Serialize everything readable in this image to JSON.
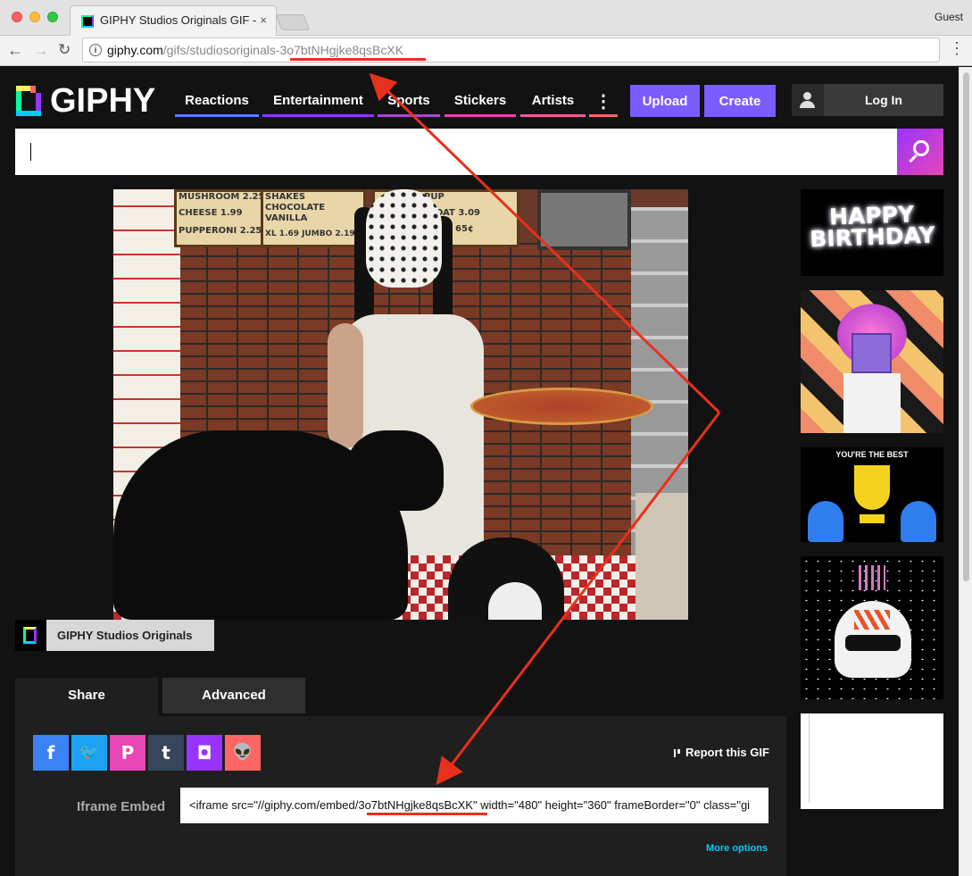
{
  "browser": {
    "tab_title": "GIPHY Studios Originals GIF - ",
    "tab_close": "×",
    "guest_label": "Guest",
    "url_domain": "giphy.com",
    "url_path": "/gifs/studiosoriginals-3o7btNHgjke8qsBcXK",
    "menu_icon": "⋮"
  },
  "header": {
    "logo_text": "GIPHY",
    "nav": [
      {
        "label": "Reactions",
        "color": "#5c7cff"
      },
      {
        "label": "Entertainment",
        "color": "#9933ff"
      },
      {
        "label": "Sports",
        "color": "#9933ff"
      },
      {
        "label": "Stickers",
        "color": "#e646b6"
      },
      {
        "label": "Artists",
        "color": "#e646b6"
      }
    ],
    "more_icon": "⋮",
    "upload_label": "Upload",
    "create_label": "Create",
    "login_label": "Log In"
  },
  "search": {
    "placeholder": ""
  },
  "gif": {
    "menu_left": [
      "MUSHROOM 2.25",
      "CHEESE 1.99",
      "PUPPERONI 2.25"
    ],
    "menu_right": [
      "SHAKES",
      "CHOCOLATE",
      "VANILLA",
      "XL 1.69 JUMBO 2.19"
    ],
    "menu_right2": [
      "PUP",
      "FLOAT 3.09",
      "65¢"
    ]
  },
  "attribution": {
    "name": "GIPHY Studios Originals"
  },
  "share": {
    "tab_share": "Share",
    "tab_advanced": "Advanced",
    "social": [
      {
        "name": "facebook",
        "glyph": "f",
        "color": "#3b82f6"
      },
      {
        "name": "twitter",
        "glyph": "🐦",
        "color": "#1da1f2"
      },
      {
        "name": "pinterest",
        "glyph": "P",
        "color": "#e646b6"
      },
      {
        "name": "tumblr",
        "glyph": "t",
        "color": "#36465d"
      },
      {
        "name": "instagram",
        "glyph": "◘",
        "color": "#9933ff"
      },
      {
        "name": "reddit",
        "glyph": "👽",
        "color": "#ff6666"
      }
    ],
    "report_label": "Report this GIF",
    "embed_label": "Iframe Embed",
    "embed_code": "<iframe src=\"//giphy.com/embed/3o7btNHgjke8qsBcXK\" width=\"480\" height=\"360\" frameBorder=\"0\" class=\"gi",
    "more_options": "More options"
  },
  "sidebar": {
    "item1_text": "HAPPY BIRTHDAY",
    "item3_text": "YOU'RE THE BEST"
  },
  "colors": {
    "annotation": "#e8301c",
    "accent_purple": "#7a5cff"
  }
}
